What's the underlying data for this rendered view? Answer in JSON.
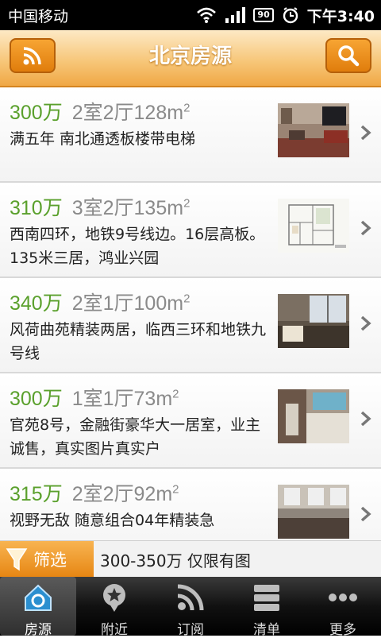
{
  "status_bar": {
    "carrier": "中国移动",
    "battery": "90",
    "time": "下午3:40"
  },
  "header": {
    "title": "北京房源",
    "left_icon": "rss-icon",
    "right_icon": "search-icon"
  },
  "listings": [
    {
      "price": "300万",
      "rooms": "2室2厅128m",
      "area_sup": "2",
      "description": "满五年 南北通透板楼带电梯"
    },
    {
      "price": "310万",
      "rooms": "3室2厅135m",
      "area_sup": "2",
      "description": "西南四环，地铁9号线边。16层高板。135米三居，鸿业兴园"
    },
    {
      "price": "340万",
      "rooms": "2室1厅100m",
      "area_sup": "2",
      "description": "风荷曲苑精装两居，临西三环和地铁九号线"
    },
    {
      "price": "300万",
      "rooms": "1室1厅73m",
      "area_sup": "2",
      "description": "官苑8号，金融街豪华大一居室，业主诚售，真实图片真实户"
    },
    {
      "price": "315万",
      "rooms": "2室2厅92m",
      "area_sup": "2",
      "description": "视野无敌 随意组合04年精装急"
    }
  ],
  "filter": {
    "label": "筛选",
    "summary": "300-350万 仅限有图"
  },
  "tabs": [
    {
      "label": "房源",
      "icon": "house-icon",
      "active": true
    },
    {
      "label": "附近",
      "icon": "location-pin-icon",
      "active": false
    },
    {
      "label": "订阅",
      "icon": "rss-icon",
      "active": false
    },
    {
      "label": "清单",
      "icon": "list-icon",
      "active": false
    },
    {
      "label": "更多",
      "icon": "more-icon",
      "active": false
    }
  ],
  "colors": {
    "accent": "#f0a845",
    "price": "#5aa02c",
    "spec": "#8a8a8a"
  }
}
